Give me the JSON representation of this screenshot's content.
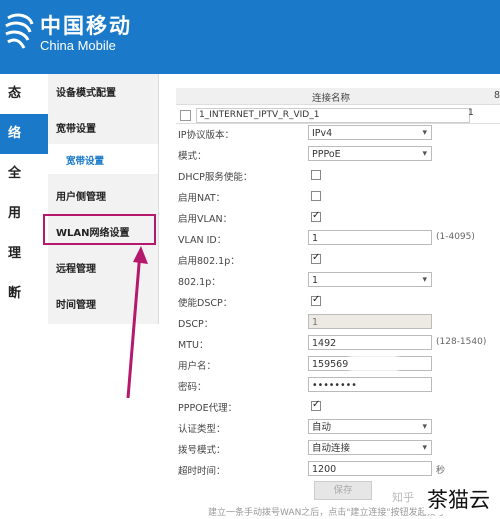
{
  "brand": {
    "name_cn": "中国移动",
    "name_en": "China Mobile",
    "color": "#1a7ac9"
  },
  "leftnav": [
    {
      "label": "态",
      "active": false
    },
    {
      "label": "络",
      "active": true
    },
    {
      "label": "全",
      "active": false
    },
    {
      "label": "用",
      "active": false
    },
    {
      "label": "理",
      "active": false
    },
    {
      "label": "断",
      "active": false
    }
  ],
  "subnav": {
    "items": [
      "设备模式配置",
      "宽带设置",
      "宽带设置",
      "用户侧管理",
      "WLAN网络设置",
      "远程管理",
      "时间管理"
    ]
  },
  "table": {
    "headers": [
      "连接名称",
      "8"
    ],
    "connection_name": "1_INTERNET_IPTV_R_VID_1",
    "connection_num": "1"
  },
  "form": {
    "ip_version": {
      "label": "IP协议版本：",
      "value": "IPv4"
    },
    "mode": {
      "label": "模式：",
      "value": "PPPoE"
    },
    "dhcp": {
      "label": "DHCP服务使能："
    },
    "nat": {
      "label": "启用NAT："
    },
    "vlan": {
      "label": "启用VLAN："
    },
    "vlan_id": {
      "label": "VLAN ID：",
      "value": "1",
      "hint": "(1-4095)"
    },
    "dot1p_enable": {
      "label": "启用802.1p："
    },
    "dot1p": {
      "label": "802.1p：",
      "value": "1"
    },
    "dscp_enable": {
      "label": "使能DSCP："
    },
    "dscp": {
      "label": "DSCP：",
      "value": "1"
    },
    "mtu": {
      "label": "MTU：",
      "value": "1492",
      "hint": "(128-1540)"
    },
    "username": {
      "label": "用户名：",
      "value": "159569"
    },
    "password": {
      "label": "密码：",
      "value": "••••••••"
    },
    "pppoe_proxy": {
      "label": "PPPOE代理："
    },
    "auth_type": {
      "label": "认证类型：",
      "value": "自动"
    },
    "dial_mode": {
      "label": "拨号模式：",
      "value": "自动连接"
    },
    "timeout": {
      "label": "超时时间：",
      "value": "1200",
      "hint": "秒"
    }
  },
  "save_label": "保存",
  "note": "建立一条手动拨号WAN之后，点击\"建立连接\"按钮发起拨号\"",
  "zhihu": "知乎",
  "watermark": "茶猫云"
}
